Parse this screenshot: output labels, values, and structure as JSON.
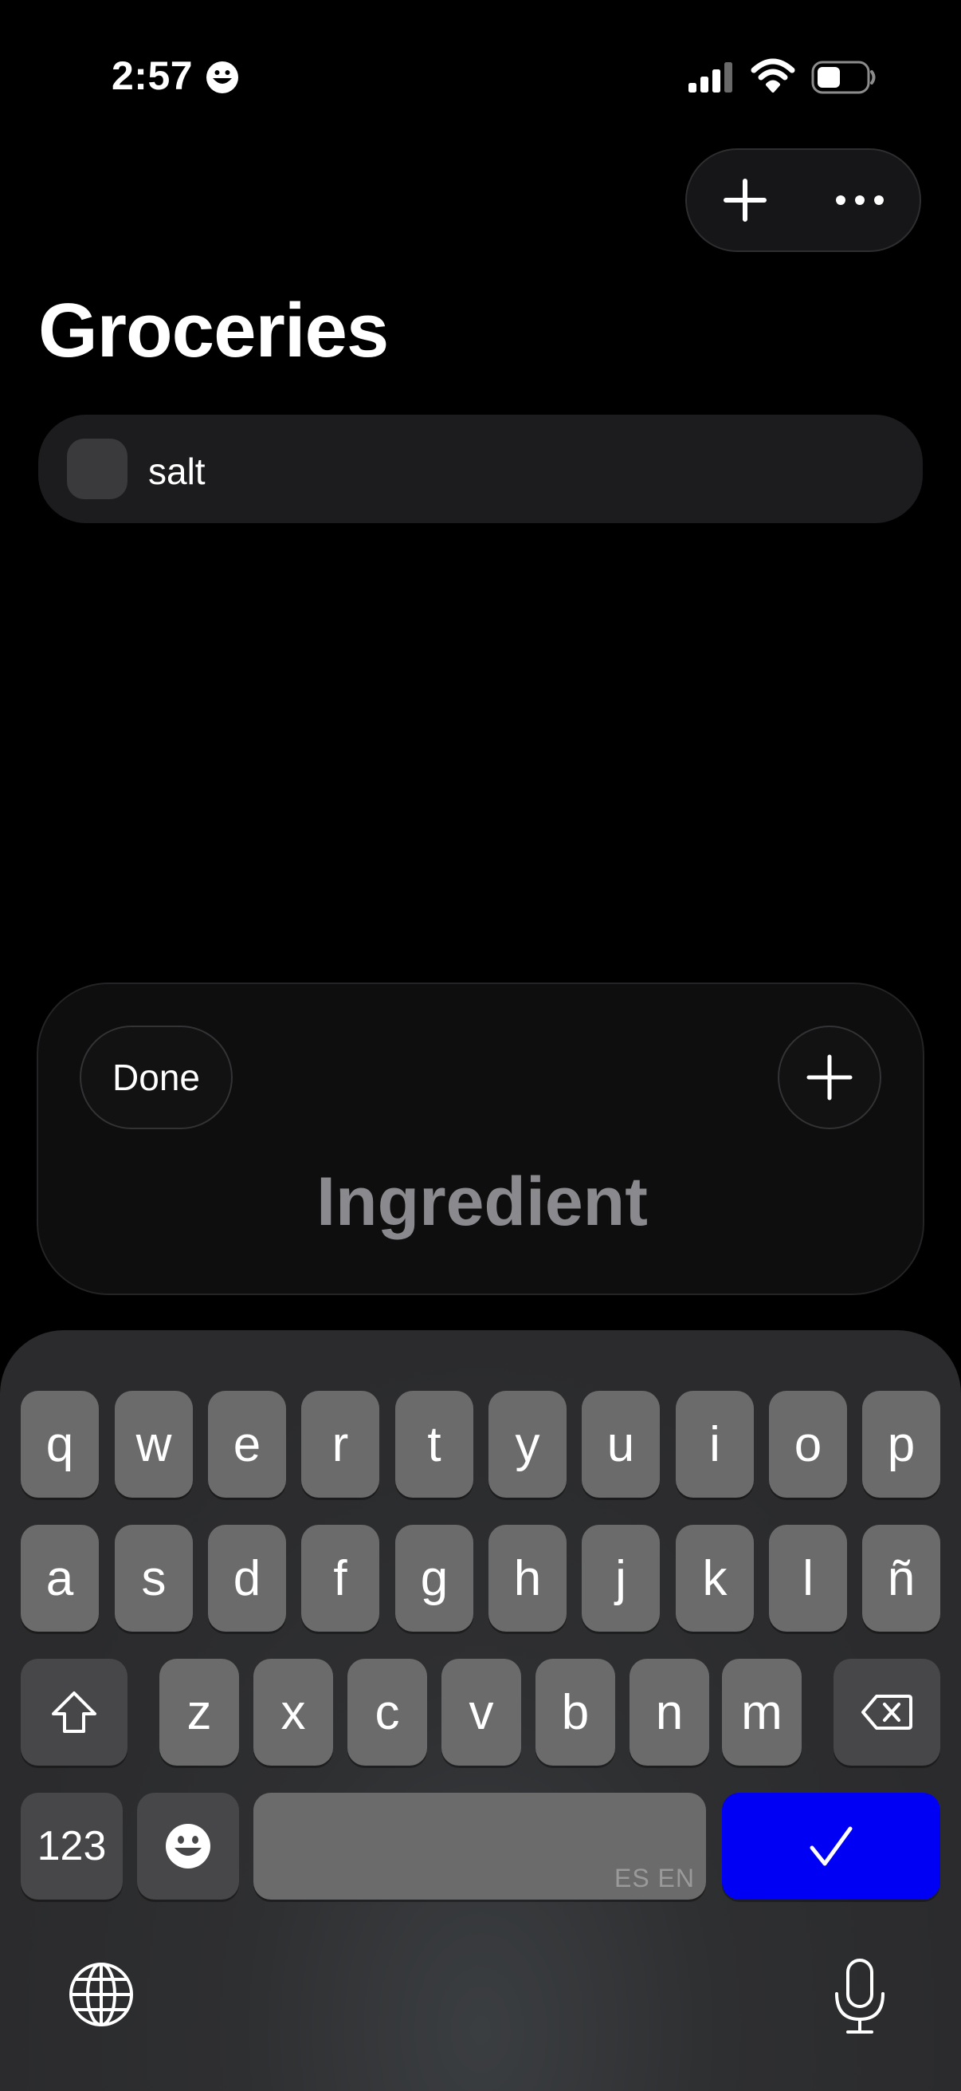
{
  "status_bar": {
    "time": "2:57",
    "emoji_icon": "grinning-face-icon",
    "signal_icon": "cellular-signal-icon",
    "wifi_icon": "wifi-icon",
    "battery_icon": "battery-icon"
  },
  "toolbar": {
    "add_icon": "plus-icon",
    "more_icon": "ellipsis-icon"
  },
  "page": {
    "title": "Groceries"
  },
  "list": {
    "items": [
      {
        "label": "salt",
        "checked": false
      }
    ]
  },
  "input_card": {
    "done_label": "Done",
    "placeholder": "Ingredient",
    "value": "",
    "add_icon": "plus-icon"
  },
  "keyboard": {
    "row1": [
      "q",
      "w",
      "e",
      "r",
      "t",
      "y",
      "u",
      "i",
      "o",
      "p"
    ],
    "row2": [
      "a",
      "s",
      "d",
      "f",
      "g",
      "h",
      "j",
      "k",
      "l",
      "ñ"
    ],
    "row3": [
      "z",
      "x",
      "c",
      "v",
      "b",
      "n",
      "m"
    ],
    "numbers_label": "123",
    "space_languages": "ES EN",
    "shift_icon": "shift-arrow-icon",
    "delete_icon": "backspace-icon",
    "emoji_icon": "emoji-face-icon",
    "confirm_icon": "checkmark-icon",
    "globe_icon": "globe-icon",
    "mic_icon": "microphone-icon",
    "confirm_color": "#0000f5"
  },
  "colors": {
    "background": "#000000",
    "card": "#1c1c1e",
    "key": "#6b6b6b",
    "placeholder": "#8a8a8e"
  }
}
